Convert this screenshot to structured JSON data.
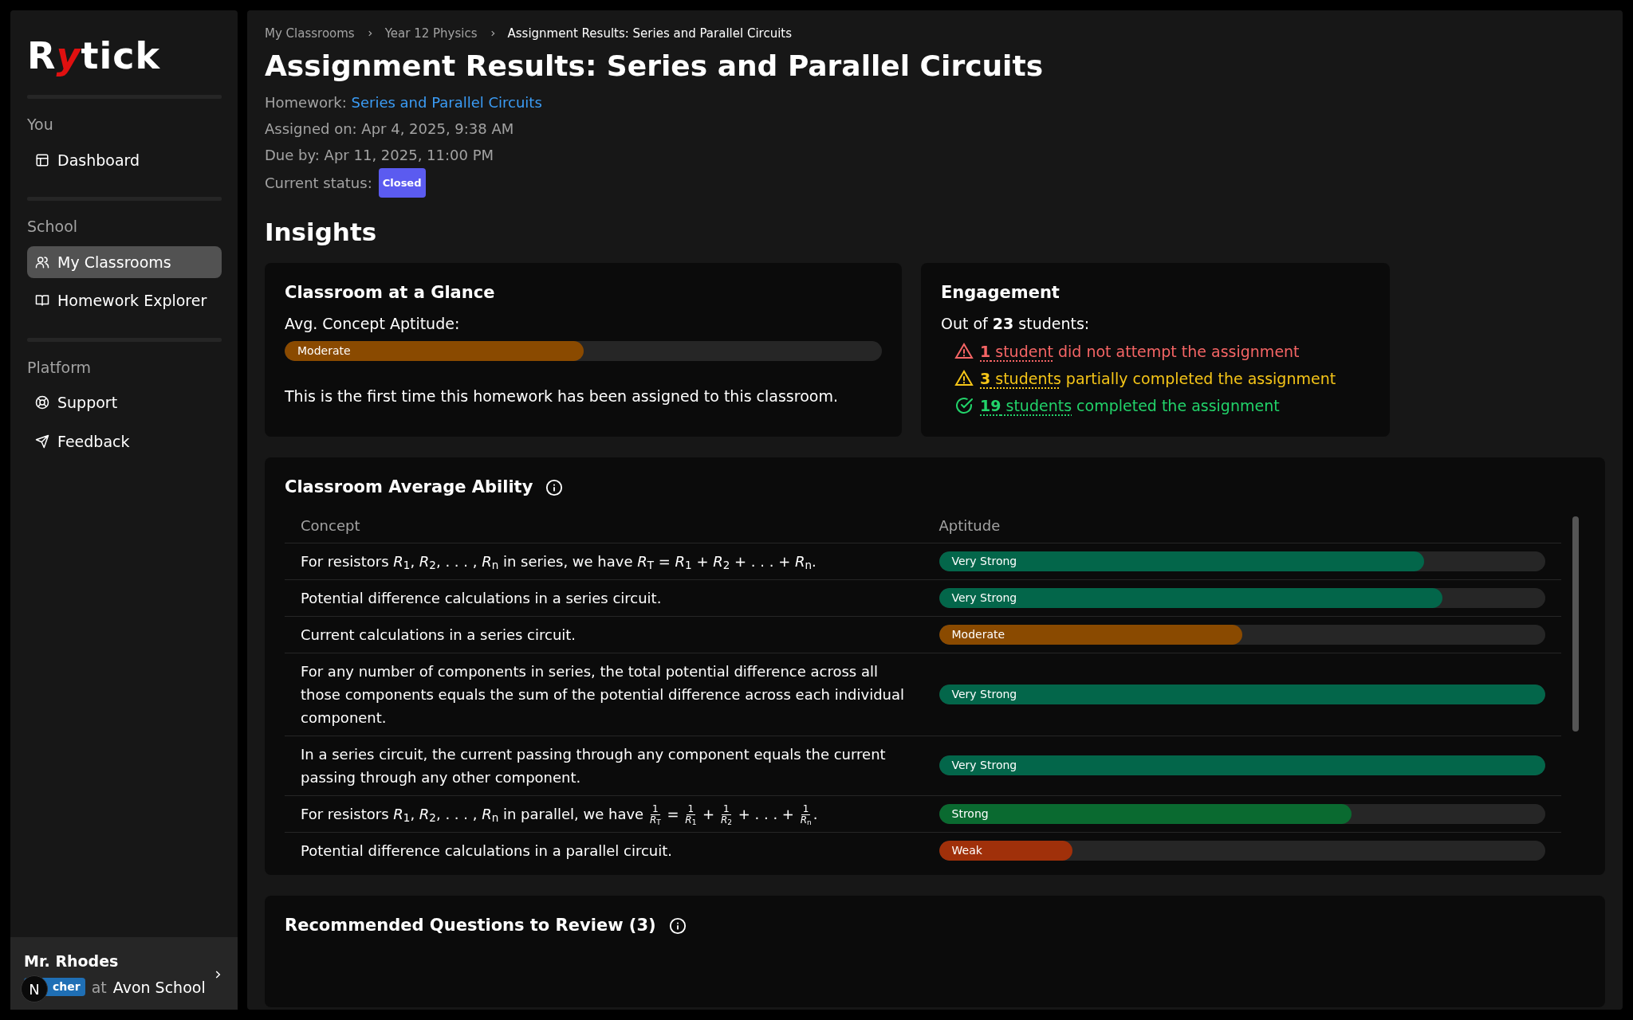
{
  "sidebar": {
    "logo": {
      "before": "R",
      "tick": "y",
      "after": "tick"
    },
    "sections": [
      {
        "title": "You",
        "items": [
          {
            "label": "Dashboard",
            "selected": false
          }
        ]
      },
      {
        "title": "School",
        "items": [
          {
            "label": "My Classrooms",
            "selected": true
          },
          {
            "label": "Homework Explorer",
            "selected": false
          }
        ]
      },
      {
        "title": "Platform",
        "items": [
          {
            "label": "Support",
            "selected": false
          },
          {
            "label": "Feedback",
            "selected": false
          }
        ]
      }
    ],
    "user": {
      "name": "Mr. Rhodes",
      "role": "cher",
      "school_prefix": "at",
      "school": "Avon School",
      "dev_badge": "N"
    }
  },
  "breadcrumb": [
    "My Classrooms",
    "Year 12 Physics",
    "Assignment Results: Series and Parallel Circuits"
  ],
  "title": "Assignment Results: Series and Parallel Circuits",
  "meta": {
    "homework_label": "Homework:",
    "homework": "Series and Parallel Circuits",
    "assigned": "Assigned on: Apr 4, 2025, 9:38 AM",
    "due": "Due by: Apr 11, 2025, 11:00 PM",
    "status_label": "Current status:",
    "status": "Closed"
  },
  "insights_title": "Insights",
  "glance": {
    "title": "Classroom at a Glance",
    "label": "Avg. Concept Aptitude:",
    "bar": {
      "label": "Moderate",
      "level": 0.5,
      "color": "#8a4a00"
    },
    "note": "This is the first time this homework has been assigned to this classroom."
  },
  "engagement": {
    "title": "Engagement",
    "summary": "Out of **23** students:",
    "items": [
      {
        "kind": "missing",
        "link": "**1** student",
        "text": "did not attempt the assignment"
      },
      {
        "kind": "partial",
        "link": "**3** students",
        "text": "partially completed the assignment"
      },
      {
        "kind": "complete",
        "link": "**19** students",
        "text": "completed the assignment"
      }
    ]
  },
  "ability": {
    "title": "Classroom Average Ability",
    "columns": [
      "Concept",
      "Aptitude"
    ],
    "rows": [
      {
        "concept": [
          {
            "kind": "text",
            "text": "For resistors *R*$_{1}$, *R*$_{2}$, . . . , *R*$_{n}$ in series, we have *R*$_{T}$ = *R*$_{1}$ + *R*$_{2}$ + . . . + *R*$_{n}$."
          }
        ],
        "label": "Very Strong",
        "level": 0.8,
        "color": "#03664a"
      },
      {
        "concept": [
          {
            "kind": "text",
            "text": "Potential difference calculations in a series circuit."
          }
        ],
        "label": "Very Strong",
        "level": 0.83,
        "color": "#03664a"
      },
      {
        "concept": [
          {
            "kind": "text",
            "text": "Current calculations in a series circuit."
          }
        ],
        "label": "Moderate",
        "level": 0.5,
        "color": "#8a4a00"
      },
      {
        "concept": [
          {
            "kind": "text",
            "text": "For any number of components in series, the total potential difference across all those components equals the sum of the potential difference across each individual component."
          }
        ],
        "label": "Very Strong",
        "level": 1,
        "color": "#03664a"
      },
      {
        "concept": [
          {
            "kind": "text",
            "text": "In a series circuit, the current passing through any component equals the current passing through any other component."
          }
        ],
        "label": "Very Strong",
        "level": 1,
        "color": "#03664a"
      },
      {
        "concept": [
          {
            "kind": "text",
            "text": "For resistors *R*$_{1}$, *R*$_{2}$, . . . , *R*$_{n}$ in parallel, we have "
          },
          {
            "kind": "frac",
            "num": "1",
            "den": "*R*$_{T}$"
          },
          {
            "kind": "text",
            "text": " = "
          },
          {
            "kind": "frac",
            "num": "1",
            "den": "*R*$_{1}$"
          },
          {
            "kind": "text",
            "text": " + "
          },
          {
            "kind": "frac",
            "num": "1",
            "den": "*R*$_{2}$"
          },
          {
            "kind": "text",
            "text": " + . . . + "
          },
          {
            "kind": "frac",
            "num": "1",
            "den": "*R*$_{n}$"
          },
          {
            "kind": "text",
            "text": "."
          }
        ],
        "label": "Strong",
        "level": 0.68,
        "color": "#0a6a30"
      },
      {
        "concept": [
          {
            "kind": "text",
            "text": "Potential difference calculations in a parallel circuit."
          }
        ],
        "label": "Weak",
        "level": 0.22,
        "color": "#a0300a"
      }
    ]
  },
  "recommended": {
    "title": "Recommended Questions to Review (3)"
  }
}
